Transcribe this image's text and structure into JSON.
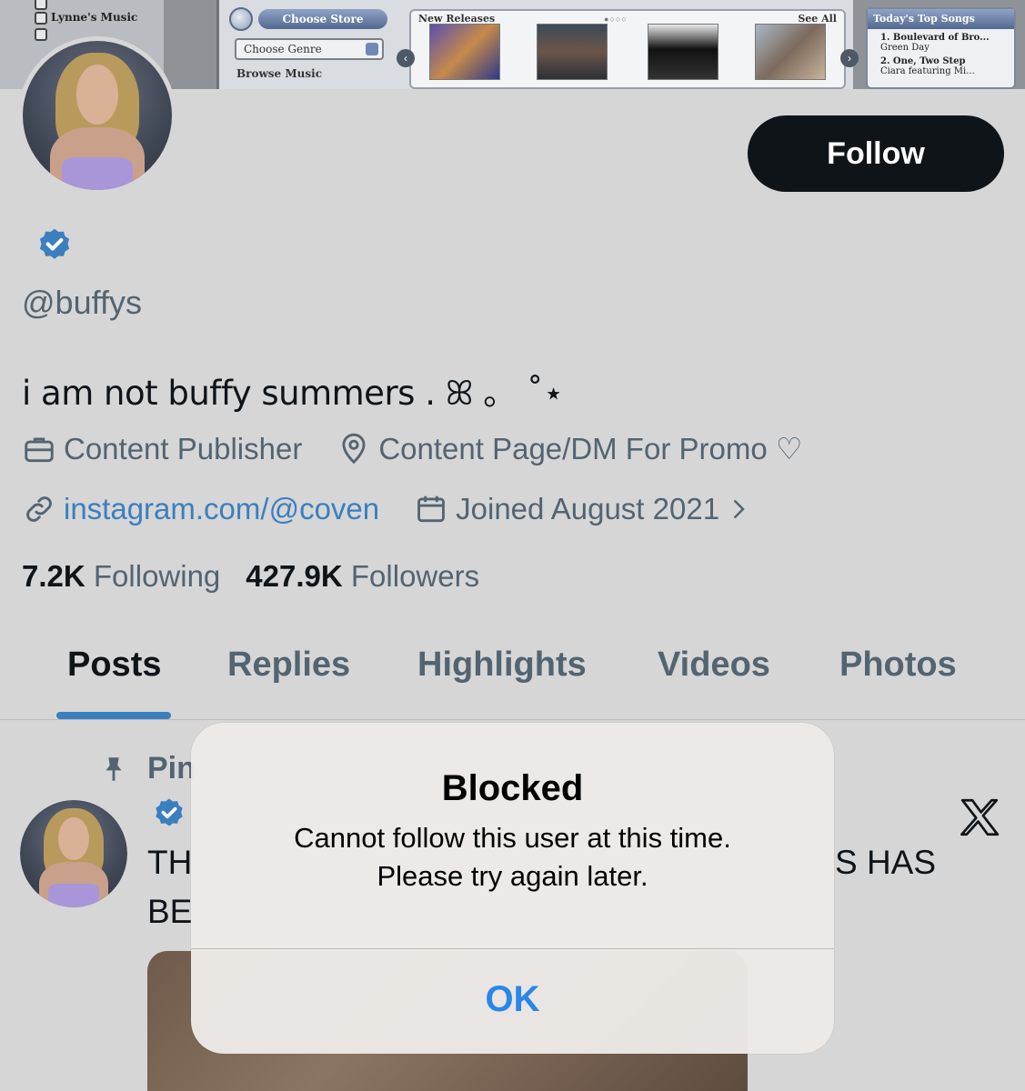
{
  "banner": {
    "sidebar_items": [
      "Lynne's Music"
    ],
    "choose_store": "Choose Store",
    "choose_genre": "Choose Genre",
    "browse_music": "Browse Music",
    "new_releases": "New Releases",
    "see_all": "See All",
    "top_songs_title": "Today's Top Songs",
    "songs": [
      {
        "line1": "1. Boulevard of Bro...",
        "line2": "Green Day"
      },
      {
        "line1": "2. One, Two Step",
        "line2": "Ciara featuring Mi..."
      }
    ]
  },
  "profile": {
    "follow_label": "Follow",
    "handle": "@buffys",
    "bio": "i am not buffy summers . ꕤ 。 ˚⋆",
    "category": "Content Publisher",
    "location": "Content Page/DM For Promo ♡",
    "website": "instagram.com/@coven",
    "joined": "Joined August 2021",
    "following_count": "7.2K",
    "following_label": "Following",
    "followers_count": "427.9K",
    "followers_label": "Followers"
  },
  "tabs": [
    "Posts",
    "Replies",
    "Highlights",
    "Videos",
    "Photos"
  ],
  "pinned_post": {
    "pin_label": "Pin",
    "text_left_1": "TH",
    "text_right_1": "S HAS",
    "text_left_2": "BE"
  },
  "dialog": {
    "title": "Blocked",
    "message_line1": "Cannot follow this user at this time.",
    "message_line2": "Please try again later.",
    "ok_label": "OK"
  },
  "colors": {
    "background": "#d6d6d6",
    "accent_blue": "#3b7fbf",
    "follow_button": "#0f1419",
    "dialog_button": "#2a86e8"
  }
}
